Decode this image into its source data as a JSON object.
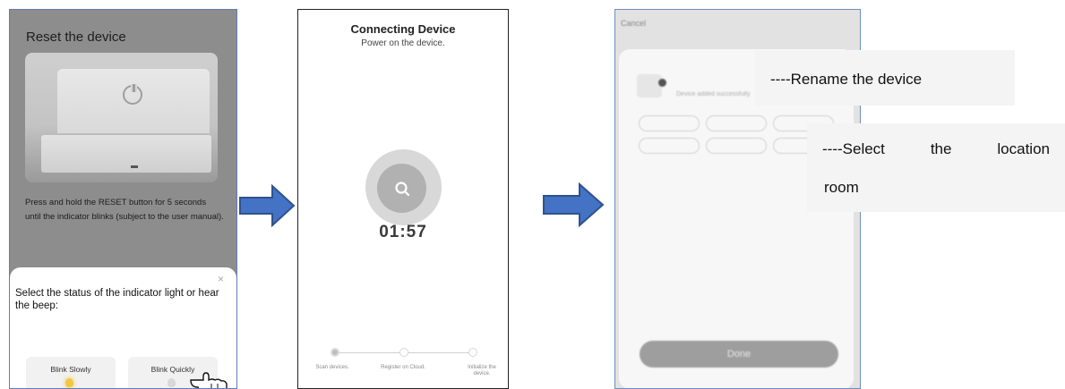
{
  "panel1": {
    "title": "Reset the device",
    "description": "Press and hold the RESET button for 5 seconds until the indicator blinks (subject to the user manual).",
    "sheet": {
      "close": "×",
      "prompt": "Select the status of the indicator light or hear the beep:",
      "options": [
        {
          "label": "Blink Slowly",
          "icon": "lit-bulb-icon"
        },
        {
          "label": "Blink Quickly",
          "icon": "unlit-bulb-icon"
        }
      ]
    }
  },
  "panel2": {
    "title": "Connecting Device",
    "subtitle": "Power on the device.",
    "timer": "01:57",
    "steps": [
      "Scan devices.",
      "Register on Cloud.",
      "Initialize the device."
    ]
  },
  "panel3": {
    "cancel": "Cancel",
    "added_text": "Device added successfully",
    "done": "Done"
  },
  "annotations": {
    "rename": "----Rename the device",
    "location_words": [
      "----Select",
      "the",
      "location"
    ],
    "location_line2": "room"
  },
  "colors": {
    "arrow_fill": "#4472c4",
    "arrow_stroke": "#2f528f",
    "panel1_overlay": "#8d8d8d",
    "panel3_overlay": "#e2e2e2"
  }
}
